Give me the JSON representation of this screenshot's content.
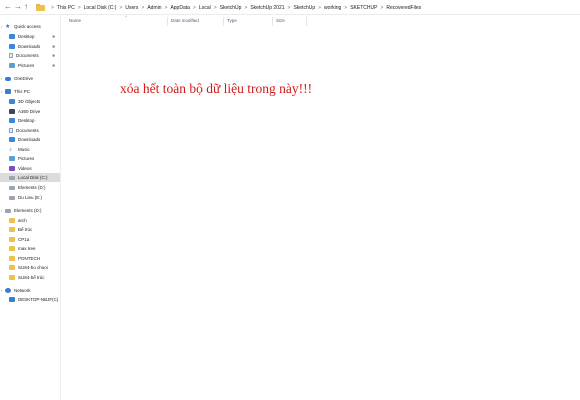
{
  "address_bar": {
    "crumbs": [
      "This PC",
      "Local Disk (C:)",
      "Users",
      "Admin",
      "AppData",
      "Local",
      "SketchUp",
      "SketchUp 2021",
      "SketchUp",
      "working",
      "SKETCHUP",
      "RecoveredFiles"
    ],
    "separator": ">"
  },
  "sidebar": {
    "items": [
      {
        "label": "Quick access",
        "icon": "star-icon",
        "level": 0
      },
      {
        "label": "Desktop",
        "icon": "desktop-icon",
        "level": 1,
        "pinned": true
      },
      {
        "label": "Downloads",
        "icon": "download-icon",
        "level": 1,
        "pinned": true
      },
      {
        "label": "Documents",
        "icon": "documents-icon",
        "level": 1,
        "pinned": true
      },
      {
        "label": "Pictures",
        "icon": "pictures-icon",
        "level": 1,
        "pinned": true
      },
      {
        "label": "OneDrive",
        "icon": "cloud-icon",
        "level": 0
      },
      {
        "label": "This PC",
        "icon": "computer-icon",
        "level": 0
      },
      {
        "label": "3D Objects",
        "icon": "3d-objects-icon",
        "level": 1
      },
      {
        "label": "A360 Drive",
        "icon": "cloud-drive-icon",
        "level": 1
      },
      {
        "label": "Desktop",
        "icon": "desktop-icon",
        "level": 1
      },
      {
        "label": "Documents",
        "icon": "documents-icon",
        "level": 1
      },
      {
        "label": "Downloads",
        "icon": "download-icon",
        "level": 1
      },
      {
        "label": "Music",
        "icon": "music-icon",
        "level": 1
      },
      {
        "label": "Pictures",
        "icon": "pictures-icon",
        "level": 1
      },
      {
        "label": "Videos",
        "icon": "video-icon",
        "level": 1
      },
      {
        "label": "Local Disk (C:)",
        "icon": "drive-icon",
        "level": 1,
        "selected": true
      },
      {
        "label": "Elements (D:)",
        "icon": "drive-icon",
        "level": 1
      },
      {
        "label": "Du Lieu (E:)",
        "icon": "drive-icon",
        "level": 1
      },
      {
        "label": "Elements (D:)",
        "icon": "drive-icon",
        "level": 0
      },
      {
        "label": "arch",
        "icon": "folder-icon",
        "level": 1
      },
      {
        "label": "Bể trúc",
        "icon": "folder-icon",
        "level": 1
      },
      {
        "label": "CP1a",
        "icon": "folder-icon",
        "level": 1
      },
      {
        "label": "max tree",
        "icon": "folder-icon",
        "level": 1
      },
      {
        "label": "PONTECH",
        "icon": "folder-icon",
        "level": 1
      },
      {
        "label": "SU84-bo chuoi",
        "icon": "folder-icon",
        "level": 1
      },
      {
        "label": "SU84-bể trúc",
        "icon": "folder-icon",
        "level": 1
      },
      {
        "label": "Network",
        "icon": "network-icon",
        "level": 0
      },
      {
        "label": "DESKTOP-NBJF(C)",
        "icon": "computer-icon",
        "level": 1
      }
    ]
  },
  "columns": [
    "Name",
    "Date modified",
    "Type",
    "Size"
  ],
  "annotation": {
    "text": "xóa hết toàn bộ dữ liệu trong này!!!",
    "color": "#d11a1a"
  }
}
